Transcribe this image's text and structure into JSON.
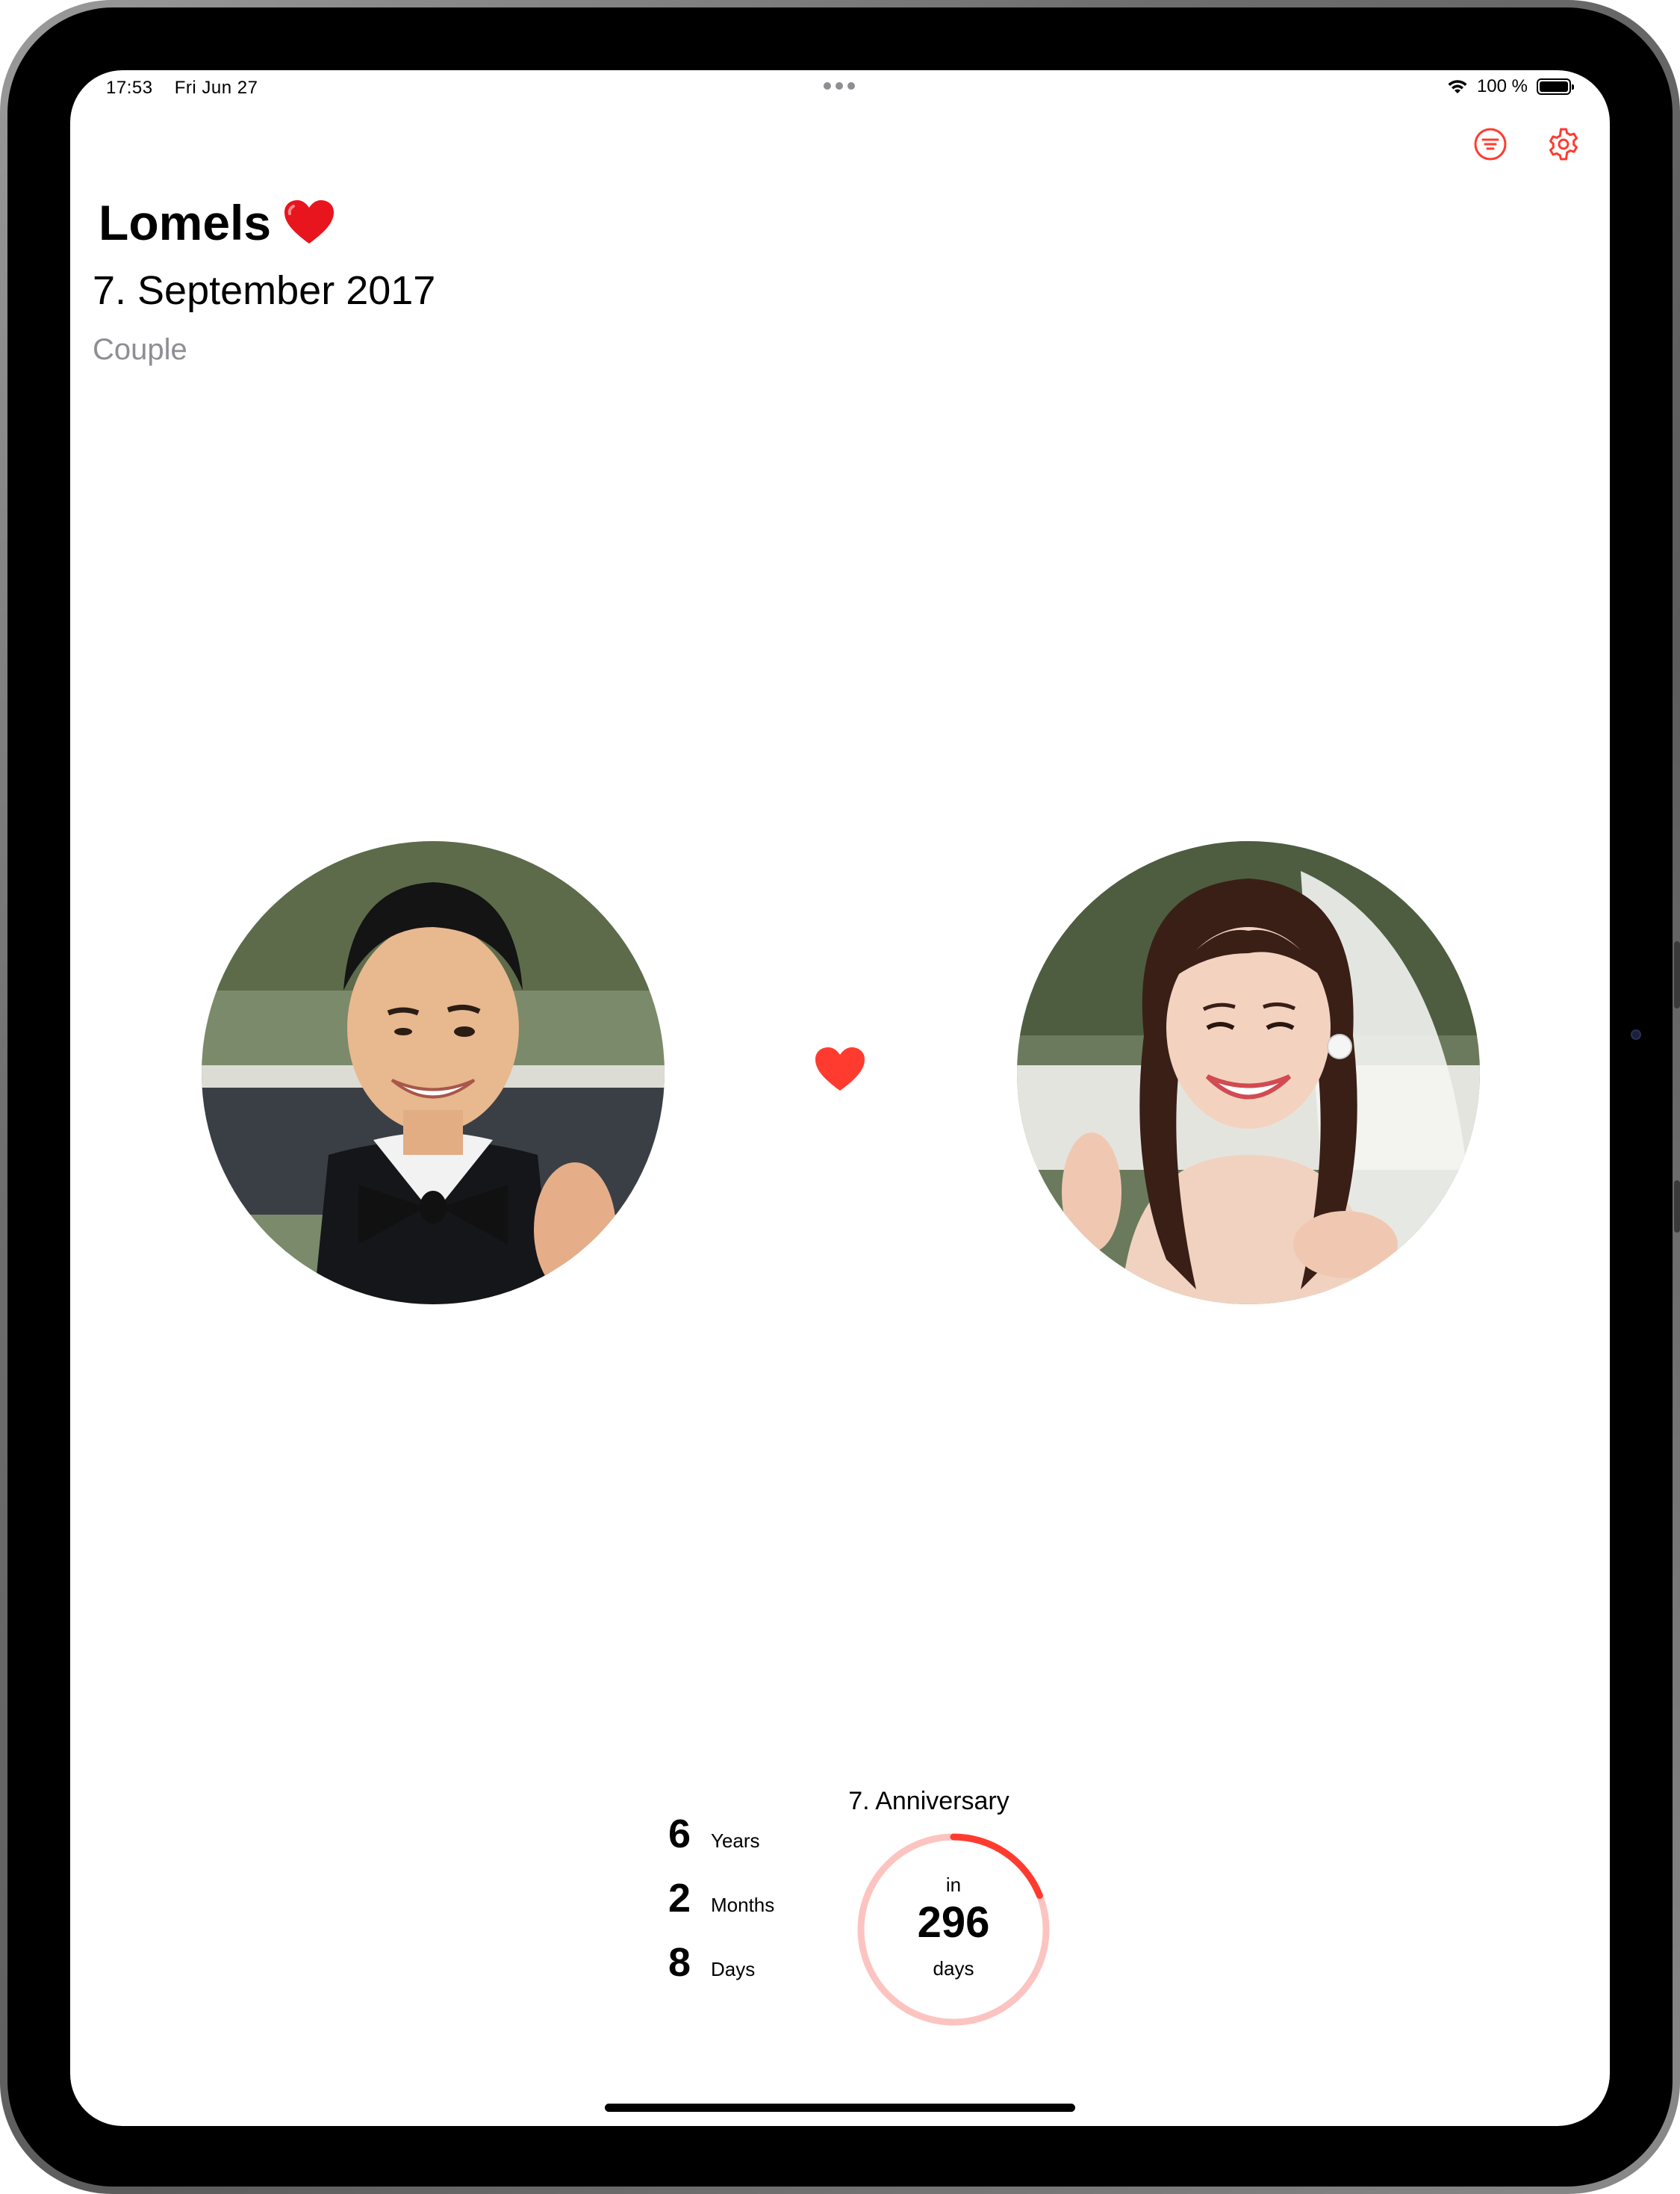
{
  "status_bar": {
    "time": "17:53",
    "date": "Fri Jun 27",
    "battery": "100 %",
    "icons": [
      "wifi-icon",
      "battery-icon"
    ]
  },
  "toolbar": {
    "filter_icon": "filter-icon",
    "settings_icon": "gear-icon",
    "accent_color": "#ff3b30"
  },
  "header": {
    "title": "Lomels",
    "title_emoji": "heart-icon",
    "date": "7. September 2017",
    "category": "Couple"
  },
  "couple": {
    "left_avatar": "groom-photo",
    "right_avatar": "bride-photo",
    "separator_icon": "heart-icon"
  },
  "duration": {
    "items": [
      {
        "value": "6",
        "unit": "Years"
      },
      {
        "value": "2",
        "unit": "Months"
      },
      {
        "value": "8",
        "unit": "Days"
      }
    ]
  },
  "anniversary": {
    "title": "7. Anniversary",
    "prefix": "in",
    "days": "296",
    "unit": "days",
    "progress": 0.19,
    "ring_color": "#ff3b30",
    "track_color": "#fcc4c0"
  }
}
